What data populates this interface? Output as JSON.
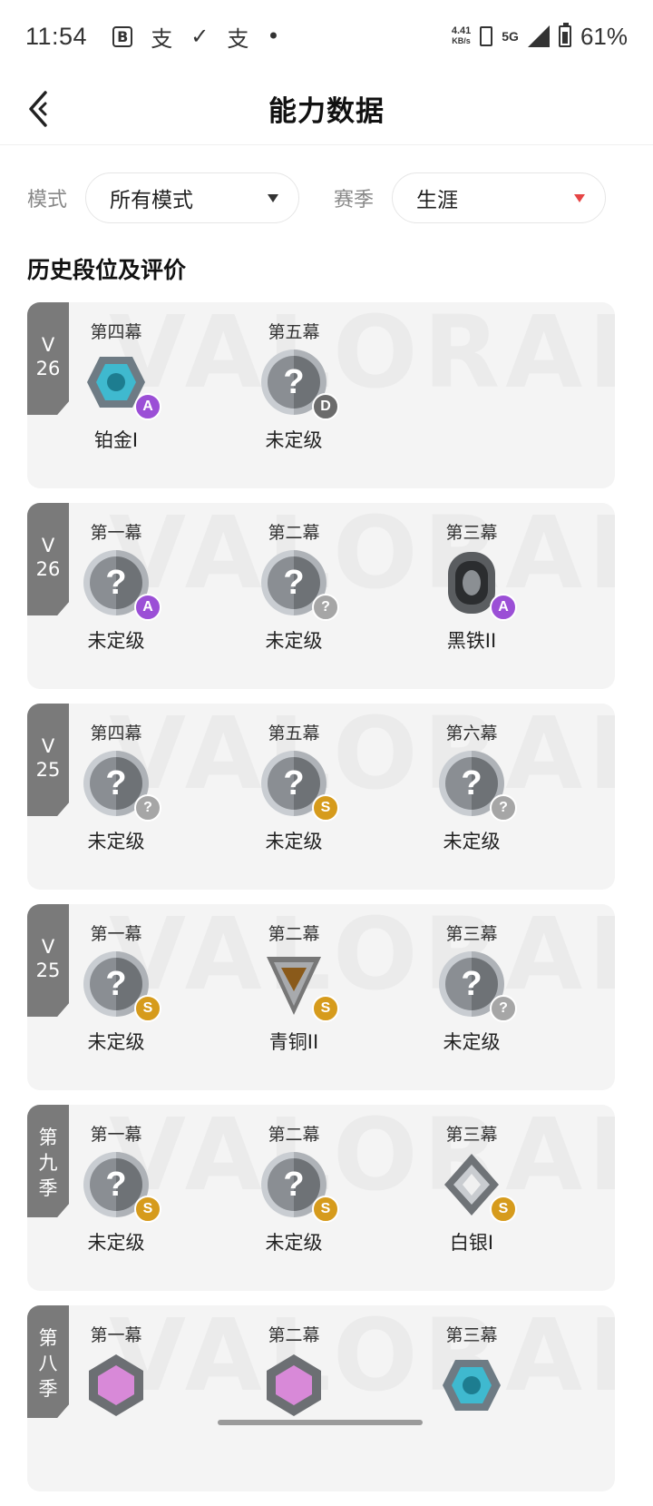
{
  "status_bar": {
    "time": "11:54",
    "notif_icons": [
      "B",
      "支",
      "✓",
      "支",
      "•"
    ],
    "speed_top": "4.41",
    "speed_bottom": "KB/s",
    "network": "5G",
    "battery_pct": "61%"
  },
  "header": {
    "title": "能力数据"
  },
  "filters": {
    "mode_label": "模式",
    "mode_value": "所有模式",
    "season_label": "赛季",
    "season_value": "生涯"
  },
  "section_title": "历史段位及评价",
  "watermark": "VALORANT",
  "seasons": [
    {
      "tag": "V\n26",
      "acts": [
        {
          "name": "第四幕",
          "rank": "铂金I",
          "badge": "A",
          "emblem": "platinum"
        },
        {
          "name": "第五幕",
          "rank": "未定级",
          "badge": "D",
          "emblem": "unrated"
        }
      ]
    },
    {
      "tag": "V\n26",
      "acts": [
        {
          "name": "第一幕",
          "rank": "未定级",
          "badge": "A",
          "emblem": "unrated"
        },
        {
          "name": "第二幕",
          "rank": "未定级",
          "badge": "?",
          "emblem": "unrated"
        },
        {
          "name": "第三幕",
          "rank": "黑铁II",
          "badge": "A",
          "emblem": "iron"
        }
      ]
    },
    {
      "tag": "V\n25",
      "acts": [
        {
          "name": "第四幕",
          "rank": "未定级",
          "badge": "?",
          "emblem": "unrated"
        },
        {
          "name": "第五幕",
          "rank": "未定级",
          "badge": "S",
          "emblem": "unrated"
        },
        {
          "name": "第六幕",
          "rank": "未定级",
          "badge": "?",
          "emblem": "unrated"
        }
      ]
    },
    {
      "tag": "V\n25",
      "acts": [
        {
          "name": "第一幕",
          "rank": "未定级",
          "badge": "S",
          "emblem": "unrated"
        },
        {
          "name": "第二幕",
          "rank": "青铜II",
          "badge": "S",
          "emblem": "bronze"
        },
        {
          "name": "第三幕",
          "rank": "未定级",
          "badge": "?",
          "emblem": "unrated"
        }
      ]
    },
    {
      "tag": "第\n九\n季",
      "acts": [
        {
          "name": "第一幕",
          "rank": "未定级",
          "badge": "S",
          "emblem": "unrated"
        },
        {
          "name": "第二幕",
          "rank": "未定级",
          "badge": "S",
          "emblem": "unrated"
        },
        {
          "name": "第三幕",
          "rank": "白银I",
          "badge": "S",
          "emblem": "silver"
        }
      ]
    },
    {
      "tag": "第\n八\n季",
      "acts": [
        {
          "name": "第一幕",
          "rank": "",
          "badge": "",
          "emblem": "diamond"
        },
        {
          "name": "第二幕",
          "rank": "",
          "badge": "",
          "emblem": "diamond"
        },
        {
          "name": "第三幕",
          "rank": "",
          "badge": "",
          "emblem": "platinum"
        }
      ]
    }
  ]
}
